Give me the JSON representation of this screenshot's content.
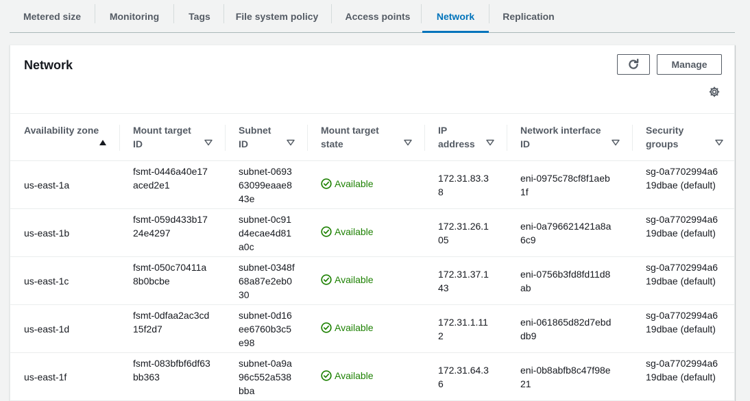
{
  "tabs": [
    {
      "label": "Metered size"
    },
    {
      "label": "Monitoring"
    },
    {
      "label": "Tags"
    },
    {
      "label": "File system policy"
    },
    {
      "label": "Access points"
    },
    {
      "label": "Network"
    },
    {
      "label": "Replication"
    }
  ],
  "active_tab": "Network",
  "panel": {
    "title": "Network",
    "manage_label": "Manage",
    "refresh_icon": "refresh-icon",
    "settings_icon": "gear-icon"
  },
  "table": {
    "columns": [
      {
        "label": "Availability zone",
        "sort": "ascending"
      },
      {
        "label": "Mount target ID",
        "sort": "none"
      },
      {
        "label": "Subnet ID",
        "sort": "none"
      },
      {
        "label": "Mount target state",
        "sort": "none"
      },
      {
        "label": "IP address",
        "sort": "none"
      },
      {
        "label": "Network interface ID",
        "sort": "none"
      },
      {
        "label": "Security groups",
        "sort": "none"
      }
    ],
    "rows": [
      {
        "az": "us-east-1a",
        "mt_id": "fsmt-0446a40e17aced2e1",
        "subnet": "subnet-069363099eaae843e",
        "state": "Available",
        "ip": "172.31.83.38",
        "eni": "eni-0975c78cf8f1aeb1f",
        "sg": "sg-0a7702994a619dbae (default)"
      },
      {
        "az": "us-east-1b",
        "mt_id": "fsmt-059d433b1724e4297",
        "subnet": "subnet-0c91d4ecae4d81a0c",
        "state": "Available",
        "ip": "172.31.26.105",
        "eni": "eni-0a796621421a8a6c9",
        "sg": "sg-0a7702994a619dbae (default)"
      },
      {
        "az": "us-east-1c",
        "mt_id": "fsmt-050c70411a8b0bcbe",
        "subnet": "subnet-0348f68a87e2eb030",
        "state": "Available",
        "ip": "172.31.37.143",
        "eni": "eni-0756b3fd8fd11d8ab",
        "sg": "sg-0a7702994a619dbae (default)"
      },
      {
        "az": "us-east-1d",
        "mt_id": "fsmt-0dfaa2ac3cd15f2d7",
        "subnet": "subnet-0d16ee6760b3c5e98",
        "state": "Available",
        "ip": "172.31.1.112",
        "eni": "eni-061865d82d7ebddb9",
        "sg": "sg-0a7702994a619dbae (default)"
      },
      {
        "az": "us-east-1f",
        "mt_id": "fsmt-083bfbf6df63bb363",
        "subnet": "subnet-0a9a96c552a538bba",
        "state": "Available",
        "ip": "172.31.64.36",
        "eni": "eni-0b8abfb8c47f98e21",
        "sg": "sg-0a7702994a619dbae (default)"
      }
    ]
  },
  "colors": {
    "accent": "#0073bb",
    "available": "#1d8102",
    "text": "#16191f",
    "muted": "#545b64"
  }
}
